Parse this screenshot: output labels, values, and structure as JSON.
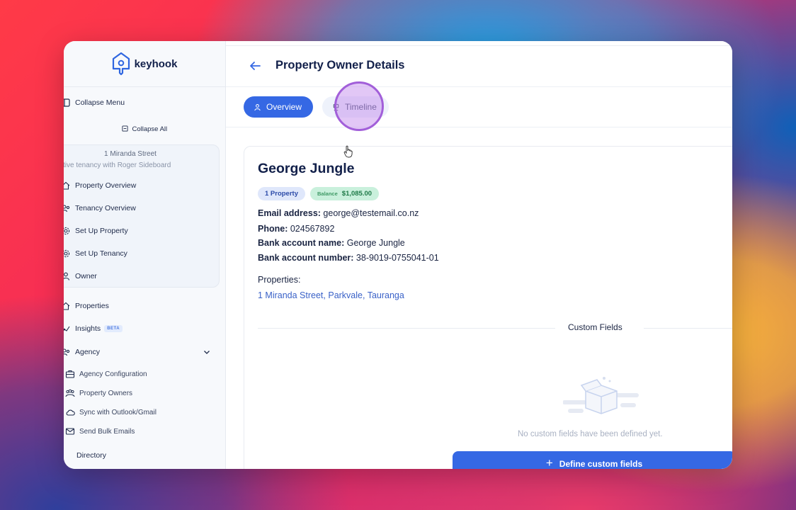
{
  "brand": {
    "name": "keyhook"
  },
  "sidebar": {
    "collapse_menu": "Collapse Menu",
    "collapse_all": "Collapse All",
    "property": {
      "address": "1 Miranda Street",
      "tenancy": "ctive tenancy with Roger Sideboard",
      "items": [
        {
          "label": "Property Overview",
          "icon": "home-icon"
        },
        {
          "label": "Tenancy Overview",
          "icon": "users-icon"
        },
        {
          "label": "Set Up Property",
          "icon": "gear-icon"
        },
        {
          "label": "Set Up Tenancy",
          "icon": "gear-icon"
        },
        {
          "label": "Owner",
          "icon": "user-icon"
        }
      ]
    },
    "nav": [
      {
        "label": "Properties",
        "icon": "home-icon"
      },
      {
        "label": "Insights",
        "icon": "chart-icon",
        "badge": "BETA"
      },
      {
        "label": "Agency",
        "icon": "users-icon"
      }
    ],
    "agency_items": [
      {
        "label": "Agency Configuration",
        "icon": "briefcase-icon"
      },
      {
        "label": "Property Owners",
        "icon": "people-icon"
      },
      {
        "label": "Sync with Outlook/Gmail",
        "icon": "cloud-icon"
      },
      {
        "label": "Send Bulk Emails",
        "icon": "mail-icon"
      }
    ],
    "directory": "Directory"
  },
  "header": {
    "title": "Property Owner Details"
  },
  "tabs": [
    {
      "label": "Overview",
      "active": true
    },
    {
      "label": "Timeline",
      "active": false
    }
  ],
  "owner": {
    "name": "George Jungle",
    "badge_properties": "1 Property",
    "badge_balance_label": "Balance",
    "badge_balance_value": "$1,085.00",
    "email_label": "Email address:",
    "email": "george@testemail.co.nz",
    "phone_label": "Phone:",
    "phone": "024567892",
    "bank_name_label": "Bank account name:",
    "bank_name": "George Jungle",
    "bank_number_label": "Bank account number:",
    "bank_number": "38-9019-0755041-01",
    "properties_label": "Properties:",
    "property_link": "1 Miranda Street, Parkvale, Tauranga"
  },
  "custom_fields": {
    "title": "Custom Fields",
    "empty_text": "No custom fields have been defined yet.",
    "define_button": "Define custom fields"
  },
  "colors": {
    "primary": "#3568e4",
    "text_dark": "#12204a",
    "link": "#3a62c8",
    "balance_bg": "#c9f0dc",
    "property_badge_bg": "#dfe7fb"
  }
}
